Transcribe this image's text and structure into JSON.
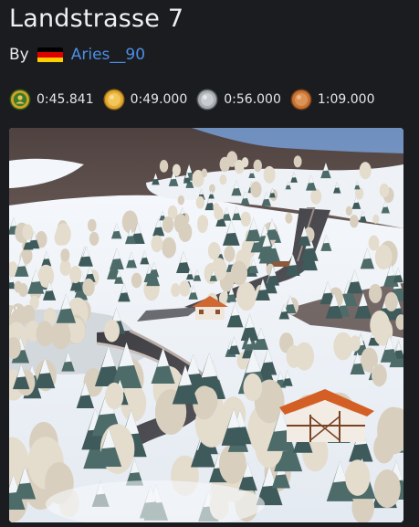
{
  "map": {
    "title": "Landstrasse 7",
    "by_label": "By",
    "author": "Aries__90",
    "author_country": "Germany",
    "author_flag_icon": "germany-flag-icon",
    "flag_colors": [
      "#000000",
      "#dd0000",
      "#ffce00"
    ]
  },
  "medals": [
    {
      "icon": "author-medal-icon",
      "time": "0:45.841",
      "color": "#3f7a2c"
    },
    {
      "icon": "gold-medal-icon",
      "time": "0:49.000",
      "color": "#d69a2a"
    },
    {
      "icon": "silver-medal-icon",
      "time": "0:56.000",
      "color": "#9aa0a6"
    },
    {
      "icon": "bronze-medal-icon",
      "time": "1:09.000",
      "color": "#c9733b"
    }
  ],
  "thumbnail": {
    "description_icon": "map-thumbnail-image"
  }
}
